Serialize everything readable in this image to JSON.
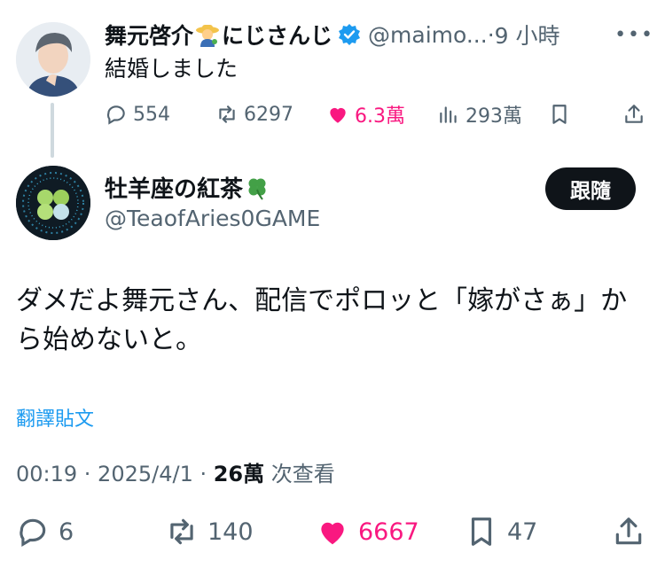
{
  "parent_tweet": {
    "display_name": "舞元啓介",
    "name_suffix": "にじさんじ",
    "handle": "@maimo...",
    "dot": "·",
    "time": "9 小時",
    "text": "結婚しました",
    "actions": {
      "replies": "554",
      "retweets": "6297",
      "likes": "6.3萬",
      "views": "293萬"
    }
  },
  "main_tweet": {
    "display_name": "牡羊座の紅茶",
    "handle": "@TeaofAries0GAME",
    "follow_label": "跟隨",
    "text": "ダメだよ舞元さん、配信でポロッと「嫁がさぁ」から始めないと。",
    "translate_label": "翻譯貼文",
    "timestamp": "00:19 · 2025/4/1 · ",
    "views_count": "26萬",
    "views_label": " 次查看",
    "actions": {
      "replies": "6",
      "retweets": "140",
      "likes": "6667",
      "bookmarks": "47"
    }
  },
  "colors": {
    "text": "#0f1419",
    "secondary": "#536471",
    "like": "#f91880",
    "link": "#1d9bf0",
    "verified": "#1d9bf0"
  }
}
